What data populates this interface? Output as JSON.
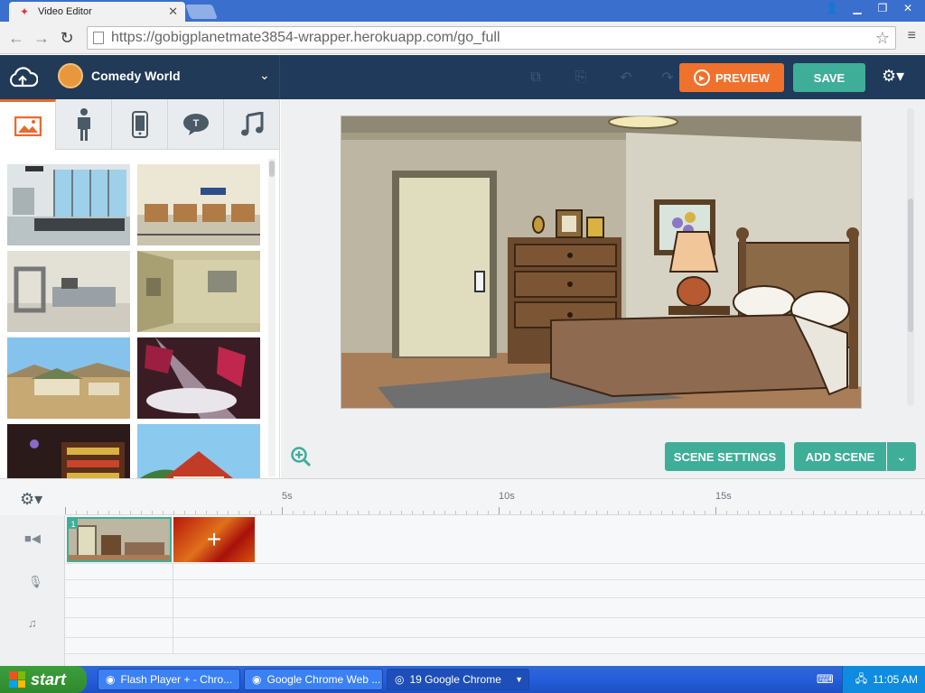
{
  "browser": {
    "tab_title": "Video Editor",
    "url": "https://gobigplanetmate3854-wrapper.herokuapp.com/go_full"
  },
  "header": {
    "project_name": "Comedy World",
    "preview_label": "PREVIEW",
    "save_label": "SAVE"
  },
  "colors": {
    "header_bg": "#1f3a5a",
    "accent_orange": "#f0712c",
    "accent_teal": "#3fae98"
  },
  "library": {
    "tabs": [
      {
        "icon": "image-icon",
        "active": true
      },
      {
        "icon": "character-icon",
        "active": false
      },
      {
        "icon": "phone-icon",
        "active": false
      },
      {
        "icon": "text-bubble-icon",
        "active": false
      },
      {
        "icon": "music-note-icon",
        "active": false
      }
    ],
    "thumbnails": [
      "airport-terminal",
      "airport-checkin",
      "security-checkpoint",
      "tent-interior",
      "desert-village",
      "stage-spotlights",
      "store-night",
      "house-exterior"
    ]
  },
  "stage": {
    "scene_settings_label": "SCENE SETTINGS",
    "add_scene_label": "ADD SCENE"
  },
  "timeline": {
    "ruler_labels": [
      "5s",
      "10s",
      "15s"
    ],
    "clip_number": "1"
  },
  "taskbar": {
    "start_label": "start",
    "items": [
      "Flash Player + - Chro...",
      "Google Chrome Web ...",
      "19 Google Chrome"
    ],
    "clock": "11:05 AM"
  }
}
